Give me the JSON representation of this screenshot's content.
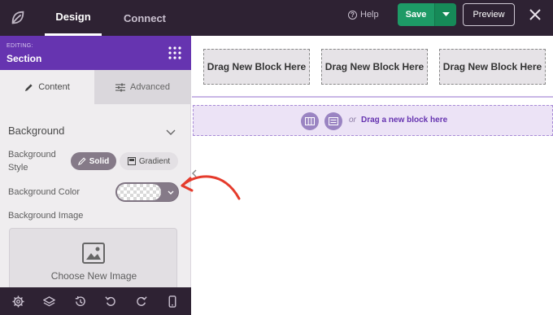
{
  "topbar": {
    "logo_icon": "seedprod-leaf-icon",
    "tabs": [
      {
        "label": "Design",
        "active": true
      },
      {
        "label": "Connect",
        "active": false
      }
    ],
    "help_label": "Help",
    "save_label": "Save",
    "preview_label": "Preview",
    "colors": {
      "bar": "#2e2233",
      "save": "#1d9a66"
    }
  },
  "sidebar": {
    "editing_label": "EDITING:",
    "section_label": "Section",
    "tabs": [
      {
        "label": "Content",
        "active": true
      },
      {
        "label": "Advanced",
        "active": false
      }
    ],
    "background_title": "Background",
    "background_style_label": "Background Style",
    "style_options": [
      {
        "label": "Solid",
        "selected": true
      },
      {
        "label": "Gradient",
        "selected": false
      }
    ],
    "background_color_label": "Background Color",
    "background_image_label": "Background Image",
    "choose_image_label": "Choose New Image",
    "colors": {
      "header": "#6634b0",
      "panel": "#efedef"
    }
  },
  "canvas": {
    "blocks": [
      "Drag New Block Here",
      "Drag New Block Here",
      "Drag New Block Here"
    ],
    "drop_or": "or",
    "drop_link": "Drag a new block here"
  }
}
